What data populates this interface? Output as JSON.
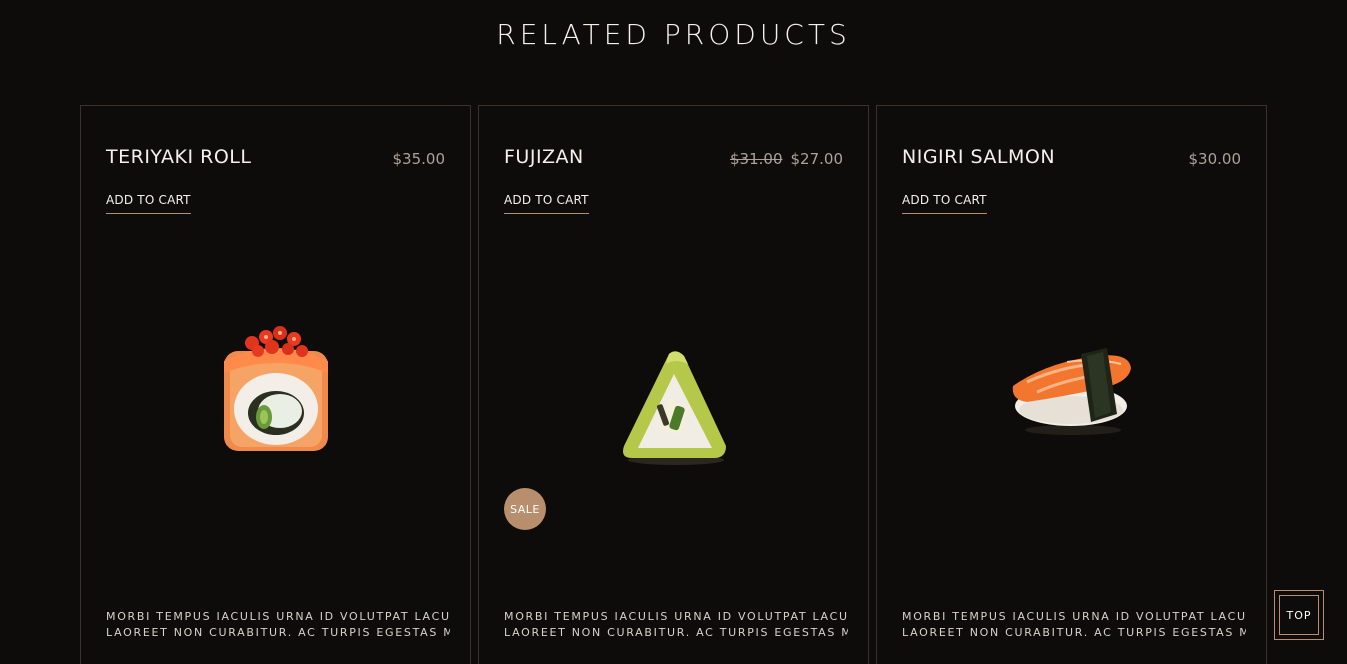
{
  "section": {
    "title": "RELATED PRODUCTS"
  },
  "products": [
    {
      "name": "TERIYAKI ROLL",
      "price": "$35.00",
      "add_to_cart": "ADD TO CART",
      "description_line1": "MORBI TEMPUS IACULIS URNA ID VOLUTPAT LACUS",
      "description_line2": "LAOREET NON CURABITUR. AC TURPIS EGESTAS MA",
      "image": "teriyaki-roll-image"
    },
    {
      "name": "FUJIZAN",
      "old_price": "$31.00",
      "price": "$27.00",
      "add_to_cart": "ADD TO CART",
      "badge": "SALE",
      "description_line1": "MORBI TEMPUS IACULIS URNA ID VOLUTPAT LACUS",
      "description_line2": "LAOREET NON CURABITUR. AC TURPIS EGESTAS MA",
      "image": "fujizan-image"
    },
    {
      "name": "NIGIRI SALMON",
      "price": "$30.00",
      "add_to_cart": "ADD TO CART",
      "description_line1": "MORBI TEMPUS IACULIS URNA ID VOLUTPAT LACUS",
      "description_line2": "LAOREET NON CURABITUR. AC TURPIS EGESTAS MA",
      "image": "nigiri-salmon-image"
    }
  ],
  "top_button": {
    "label": "TOP"
  },
  "colors": {
    "background": "#0e0c0a",
    "accent": "#b88e6d",
    "border": "#3a332c",
    "text": "#f4f1ec",
    "muted": "#a9a39b"
  }
}
